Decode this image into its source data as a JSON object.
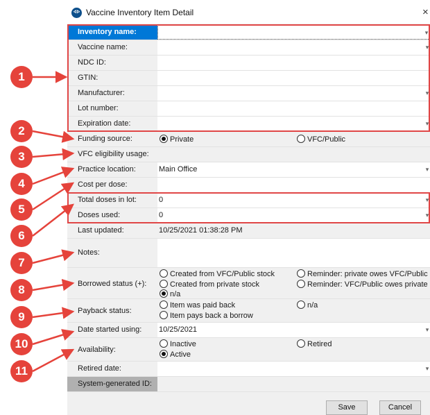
{
  "window": {
    "title": "Vaccine Inventory Item Detail",
    "close_glyph": "×",
    "app_icon_text": "ᐊᐅ"
  },
  "fields": {
    "inventory_name": {
      "label": "Inventory name:",
      "value": ""
    },
    "vaccine_name": {
      "label": "Vaccine name:",
      "value": ""
    },
    "ndc_id": {
      "label": "NDC ID:",
      "value": ""
    },
    "gtin": {
      "label": "GTIN:",
      "value": ""
    },
    "manufacturer": {
      "label": "Manufacturer:",
      "value": ""
    },
    "lot_number": {
      "label": "Lot number:",
      "value": ""
    },
    "expiration_date": {
      "label": "Expiration date:",
      "value": ""
    },
    "funding_source": {
      "label": "Funding source:",
      "options": [
        "Private",
        "VFC/Public"
      ],
      "selected": "Private"
    },
    "vfc_eligibility": {
      "label": "VFC eligibility usage:",
      "value": ""
    },
    "practice_location": {
      "label": "Practice location:",
      "value": "Main Office"
    },
    "cost_per_dose": {
      "label": "Cost per dose:",
      "value": ""
    },
    "total_doses": {
      "label": "Total doses in lot:",
      "value": "0"
    },
    "doses_used": {
      "label": "Doses used:",
      "value": "0"
    },
    "last_updated": {
      "label": "Last updated:",
      "value": "10/25/2021 01:38:28 PM"
    },
    "notes": {
      "label": "Notes:",
      "value": ""
    },
    "borrowed_status": {
      "label": "Borrowed status (+):",
      "options": [
        "Created from VFC/Public stock",
        "Reminder: private owes VFC/Public",
        "Created from private stock",
        "Reminder: VFC/Public owes private",
        "n/a"
      ],
      "selected": "n/a"
    },
    "payback_status": {
      "label": "Payback status:",
      "options": [
        "Item was paid back",
        "n/a",
        "Item pays back a borrow"
      ],
      "selected": ""
    },
    "date_started": {
      "label": "Date started using:",
      "value": "10/25/2021"
    },
    "availability": {
      "label": "Availability:",
      "options": [
        "Inactive",
        "Retired",
        "Active"
      ],
      "selected": "Active"
    },
    "retired_date": {
      "label": "Retired date:",
      "value": ""
    },
    "system_id": {
      "label": "System-generated ID:",
      "value": ""
    }
  },
  "buttons": {
    "save": "Save",
    "cancel": "Cancel"
  },
  "annotations": [
    "1",
    "2",
    "3",
    "4",
    "5",
    "6",
    "7",
    "8",
    "9",
    "10",
    "11"
  ],
  "colors": {
    "annotation": "#e5433b",
    "selected_row": "#0078d7"
  }
}
